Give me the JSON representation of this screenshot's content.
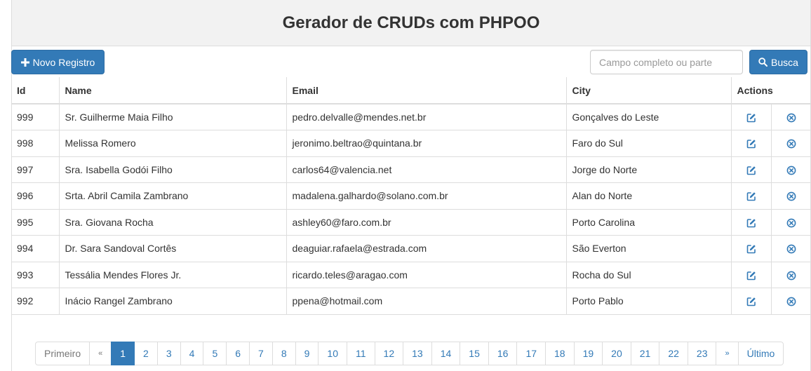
{
  "header": {
    "title": "Gerador de CRUDs com PHPOO"
  },
  "toolbar": {
    "new_label": "Novo Registro",
    "search_placeholder": "Campo completo ou parte",
    "search_value": "",
    "search_label": "Busca"
  },
  "table": {
    "columns": [
      "Id",
      "Name",
      "Email",
      "City",
      "Actions"
    ],
    "rows": [
      {
        "id": "999",
        "name": "Sr. Guilherme Maia Filho",
        "email": "pedro.delvalle@mendes.net.br",
        "city": "Gonçalves do Leste"
      },
      {
        "id": "998",
        "name": "Melissa Romero",
        "email": "jeronimo.beltrao@quintana.br",
        "city": "Faro do Sul"
      },
      {
        "id": "997",
        "name": "Sra. Isabella Godói Filho",
        "email": "carlos64@valencia.net",
        "city": "Jorge do Norte"
      },
      {
        "id": "996",
        "name": "Srta. Abril Camila Zambrano",
        "email": "madalena.galhardo@solano.com.br",
        "city": "Alan do Norte"
      },
      {
        "id": "995",
        "name": "Sra. Giovana Rocha",
        "email": "ashley60@faro.com.br",
        "city": "Porto Carolina"
      },
      {
        "id": "994",
        "name": "Dr. Sara Sandoval Cortês",
        "email": "deaguiar.rafaela@estrada.com",
        "city": "São Everton"
      },
      {
        "id": "993",
        "name": "Tessália Mendes Flores Jr.",
        "email": "ricardo.teles@aragao.com",
        "city": "Rocha do Sul"
      },
      {
        "id": "992",
        "name": "Inácio Rangel Zambrano",
        "email": "ppena@hotmail.com",
        "city": "Porto Pablo"
      }
    ]
  },
  "pagination": {
    "first": "Primeiro",
    "prev": "«",
    "pages": [
      "1",
      "2",
      "3",
      "4",
      "5",
      "6",
      "7",
      "8",
      "9",
      "10",
      "11",
      "12",
      "13",
      "14",
      "15",
      "16",
      "17",
      "18",
      "19",
      "20",
      "21",
      "22",
      "23"
    ],
    "current": "1",
    "next": "»",
    "last": "Último"
  },
  "colors": {
    "primary": "#337ab7",
    "border": "#dddddd",
    "header_bg": "#f2f2f2"
  },
  "icons": {
    "new": "plus-icon",
    "search": "search-icon",
    "edit": "edit-icon",
    "delete": "delete-circle-icon"
  }
}
